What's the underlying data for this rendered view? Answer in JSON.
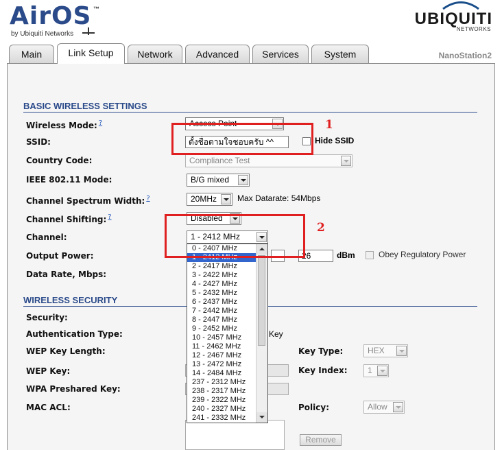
{
  "header": {
    "logo_text": "AirOS",
    "logo_tm": "™",
    "logo_sub": "by Ubiquiti Networks",
    "brand": "UBIQUITI",
    "brand_sub": "NETWORKS",
    "device": "NanoStation2"
  },
  "tabs": [
    {
      "label": "Main"
    },
    {
      "label": "Link Setup"
    },
    {
      "label": "Network"
    },
    {
      "label": "Advanced"
    },
    {
      "label": "Services"
    },
    {
      "label": "System"
    }
  ],
  "basic": {
    "title": "BASIC WIRELESS SETTINGS",
    "wireless_mode_label": "Wireless Mode:",
    "wireless_mode_value": "Access Point",
    "ssid_label": "SSID:",
    "ssid_value": "ตั้งชื่อตามใจชอบครับ ^^",
    "hide_ssid_label": "Hide SSID",
    "country_label": "Country Code:",
    "country_value": "Compliance Test",
    "ieee_label": "IEEE 802.11 Mode:",
    "ieee_value": "B/G mixed",
    "width_label": "Channel Spectrum Width:",
    "width_value": "20MHz",
    "max_datarate": "Max Datarate: 54Mbps",
    "shifting_label": "Channel Shifting:",
    "shifting_value": "Disabled",
    "channel_label": "Channel:",
    "channel_value": "1 - 2412 MHz",
    "power_label": "Output Power:",
    "power_value": "26",
    "power_unit": "dBm",
    "obey_label": "Obey Regulatory Power",
    "datarate_label": "Data Rate, Mbps:",
    "help": "?"
  },
  "security": {
    "title": "WIRELESS SECURITY",
    "security_label": "Security:",
    "auth_label": "Authentication Type:",
    "auth_suffix": "Key",
    "wep_len_label": "WEP Key Length:",
    "key_type_label": "Key Type:",
    "key_type_value": "HEX",
    "wep_key_label": "WEP Key:",
    "key_index_label": "Key Index:",
    "key_index_value": "1",
    "wpa_label": "WPA Preshared Key:",
    "mac_acl_label": "MAC ACL:",
    "policy_label": "Policy:",
    "policy_value": "Allow",
    "remove_label": "Remove"
  },
  "annotations": {
    "mark1": "1",
    "mark2": "2"
  },
  "channel_options": [
    "0 - 2407 MHz",
    "1 - 2412 MHz",
    "2 - 2417 MHz",
    "3 - 2422 MHz",
    "4 - 2427 MHz",
    "5 - 2432 MHz",
    "6 - 2437 MHz",
    "7 - 2442 MHz",
    "8 - 2447 MHz",
    "9 - 2452 MHz",
    "10 - 2457 MHz",
    "11 - 2462 MHz",
    "12 - 2467 MHz",
    "13 - 2472 MHz",
    "14 - 2484 MHz",
    "237 - 2312 MHz",
    "238 - 2317 MHz",
    "239 - 2322 MHz",
    "240 - 2327 MHz",
    "241 - 2332 MHz"
  ],
  "selected_channel_index": 1,
  "colors": {
    "section": "#2a4a8a",
    "annotation": "#e02020",
    "selection": "#3366cc"
  }
}
